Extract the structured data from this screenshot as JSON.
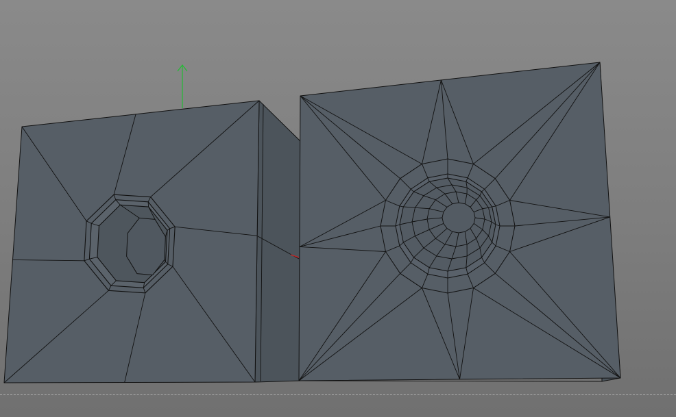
{
  "viewport": {
    "kind": "3d-modeling-viewport",
    "shading": "wireframe-on-shaded",
    "background_color": "#7f7f7f",
    "mesh_face_color": "#565e66",
    "mesh_side_color": "#4c545b",
    "wire_color": "#111111"
  },
  "objects": [
    {
      "name": "cube-with-octagonal-hole",
      "hole_sides": 8,
      "inset_rings": 3
    },
    {
      "name": "cube-with-spherical-dimple",
      "star_points": 8,
      "dimple_rings": 4
    }
  ],
  "gizmo": {
    "y_axis_color": "#22bb33",
    "x_axis_color": "#cc2222"
  }
}
